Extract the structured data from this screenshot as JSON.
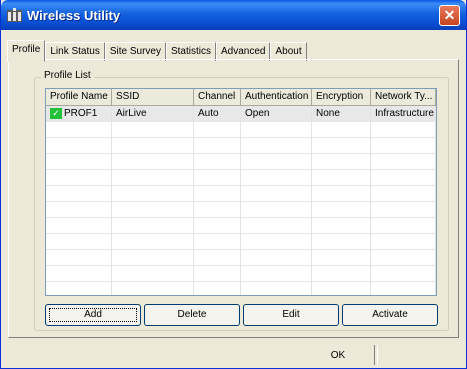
{
  "window": {
    "title": "Wireless Utility",
    "close_symbol": "✕"
  },
  "tabs": [
    {
      "label": "Profile",
      "active": true
    },
    {
      "label": "Link Status"
    },
    {
      "label": "Site Survey"
    },
    {
      "label": "Statistics"
    },
    {
      "label": "Advanced"
    },
    {
      "label": "About"
    }
  ],
  "profile_list": {
    "label": "Profile List",
    "columns": [
      "Profile Name",
      "SSID",
      "Channel",
      "Authentication",
      "Encryption",
      "Network Ty..."
    ],
    "rows": [
      {
        "profile_name": "PROF1",
        "ssid": "AirLive",
        "channel": "Auto",
        "authentication": "Open",
        "encryption": "None",
        "network_type": "Infrastructure",
        "active": true
      }
    ]
  },
  "buttons": {
    "add": "Add",
    "delete": "Delete",
    "edit": "Edit",
    "activate": "Activate",
    "ok": "OK"
  },
  "colors": {
    "title_bar": "#0a58e6",
    "close_button": "#c7431f",
    "active_check": "#24c23a",
    "dialog_bg": "#ece9d8"
  }
}
